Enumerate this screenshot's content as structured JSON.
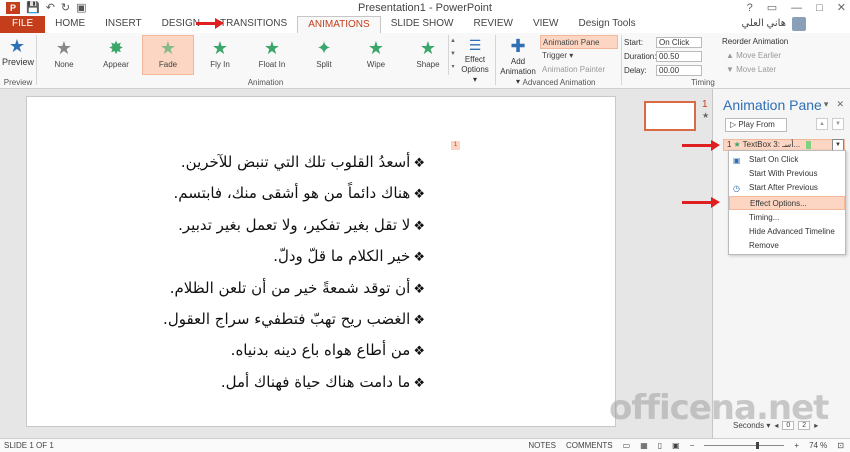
{
  "window": {
    "title": "Presentation1 - PowerPoint",
    "user": "هاني العلي",
    "controls": [
      "?",
      "▭",
      "—",
      "□",
      "✕"
    ]
  },
  "qat": {
    "logo": "P",
    "save": "💾",
    "undo": "↶",
    "redo": "↻",
    "present": "▣"
  },
  "tabs": [
    "FILE",
    "HOME",
    "INSERT",
    "DESIGN",
    "TRANSITIONS",
    "ANIMATIONS",
    "SLIDE SHOW",
    "REVIEW",
    "VIEW",
    "Design Tools"
  ],
  "ribbon": {
    "preview": {
      "label": "Preview",
      "group": "Preview"
    },
    "animations": [
      {
        "name": "None",
        "icon": "★"
      },
      {
        "name": "Appear",
        "icon": "✸"
      },
      {
        "name": "Fade",
        "icon": "★"
      },
      {
        "name": "Fly In",
        "icon": "★"
      },
      {
        "name": "Float In",
        "icon": "★"
      },
      {
        "name": "Split",
        "icon": "✦"
      },
      {
        "name": "Wipe",
        "icon": "★"
      },
      {
        "name": "Shape",
        "icon": "★"
      }
    ],
    "effect_options": {
      "line1": "Effect",
      "line2": "Options ▾"
    },
    "animation_group": "Animation",
    "add_animation": {
      "line1": "Add",
      "line2": "Animation ▾"
    },
    "advanced": [
      "Animation Pane",
      "Trigger ▾",
      "Animation Painter"
    ],
    "advanced_group": "Advanced Animation",
    "timing": {
      "start_label": "Start:",
      "start_value": "On Click",
      "duration_label": "Duration:",
      "duration_value": "00.50",
      "delay_label": "Delay:",
      "delay_value": "00.00"
    },
    "reorder": {
      "title": "Reorder Animation",
      "earlier": "▲ Move Earlier",
      "later": "▼ Move Later"
    },
    "timing_group": "Timing"
  },
  "slide": {
    "anim_tag": "1",
    "bullet": "❖",
    "lines": [
      "أسعدُ القلوب تلك التي تنبض للآخرين.",
      "هناك دائماً من هو أشقى منك، فابتسم.",
      "لا تقل بغير تفكير، ولا تعمل بغير تدبير.",
      "خير الكلام ما قلّ ودلّ.",
      "أن توقد شمعةً خير من أن تلعن الظلام.",
      "الغضب ريح تهبّ فتطفيء سراج العقول.",
      "من أطاع هواه باع دينه بدنياه.",
      "ما دامت هناك حياة فهناك أمل."
    ]
  },
  "thumbnail": {
    "number": "1",
    "star": "★"
  },
  "pane": {
    "title": "Animation Pane",
    "play_from": "▷  Play From",
    "item": {
      "index": "1",
      "label": "TextBox 3: أسـ..."
    },
    "menu": [
      "Start On Click",
      "Start With Previous",
      "Start After Previous",
      "Effect Options...",
      "Timing...",
      "Hide Advanced Timeline",
      "Remove"
    ],
    "footer": {
      "label": "Seconds ▾",
      "start": "0",
      "end": "2"
    }
  },
  "status": {
    "slide": "SLIDE 1 OF 1",
    "notes": "NOTES",
    "comments": "COMMENTS",
    "zoom": "74 %"
  },
  "watermark": "officena.net"
}
